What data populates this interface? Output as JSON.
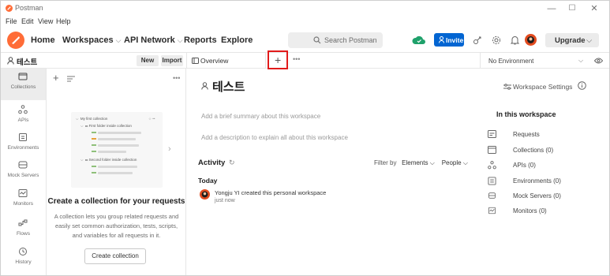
{
  "window": {
    "title": "Postman",
    "controls": {
      "minimize": "—",
      "maximize": "☐",
      "close": "✕"
    }
  },
  "menubar": {
    "items": [
      "File",
      "Edit",
      "View",
      "Help"
    ]
  },
  "header": {
    "nav": {
      "home": "Home",
      "workspaces": "Workspaces",
      "api_network": "API Network",
      "reports": "Reports",
      "explore": "Explore"
    },
    "search_placeholder": "Search Postman",
    "invite_label": "Invite",
    "upgrade_label": "Upgrade",
    "icons": [
      "sync-icon",
      "satellite-icon",
      "settings-icon",
      "bell-icon",
      "avatar"
    ]
  },
  "workspace": {
    "name": "테스트",
    "new_label": "New",
    "import_label": "Import"
  },
  "tabs": {
    "overview_label": "Overview",
    "new_tab_symbol": "+",
    "more_symbol": "•••",
    "environment": "No Environment"
  },
  "rail": {
    "items": [
      {
        "label": "Collections",
        "icon": "collections-icon"
      },
      {
        "label": "APIs",
        "icon": "apis-icon"
      },
      {
        "label": "Environments",
        "icon": "environments-icon"
      },
      {
        "label": "Mock Servers",
        "icon": "mock-servers-icon"
      },
      {
        "label": "Monitors",
        "icon": "monitors-icon"
      },
      {
        "label": "Flows",
        "icon": "flows-icon"
      },
      {
        "label": "History",
        "icon": "history-icon"
      }
    ]
  },
  "sidebar": {
    "illustration": {
      "collection": "My first collection",
      "folder1": "First folder inside collection",
      "folder2": "Second folder inside collection"
    },
    "empty_title": "Create a collection for your requests",
    "empty_description": "A collection lets you group related requests and easily set common authorization, tests, scripts, and variables for all requests in it.",
    "create_button": "Create collection"
  },
  "main": {
    "title": "테스트",
    "settings_label": "Workspace Settings",
    "summary_placeholder": "Add a brief summary about this workspace",
    "description_placeholder": "Add a description to explain all about this workspace",
    "activity": {
      "heading": "Activity",
      "filter_by": "Filter by",
      "elements": "Elements",
      "people": "People",
      "today": "Today",
      "entry_text": "Yongju YI created this personal workspace",
      "entry_time": "just now"
    },
    "in_workspace": {
      "heading": "In this workspace",
      "items": [
        {
          "label": "Requests",
          "icon": "requests-icon"
        },
        {
          "label": "Collections (0)",
          "icon": "collections-icon"
        },
        {
          "label": "APIs (0)",
          "icon": "apis-icon"
        },
        {
          "label": "Environments (0)",
          "icon": "environments-icon"
        },
        {
          "label": "Mock Servers (0)",
          "icon": "mock-servers-icon"
        },
        {
          "label": "Monitors (0)",
          "icon": "monitors-icon"
        }
      ]
    }
  },
  "colors": {
    "brand": "#ff6c37",
    "invite": "#0265d2",
    "highlight": "#e21b1b",
    "sync": "#1fa16b"
  }
}
